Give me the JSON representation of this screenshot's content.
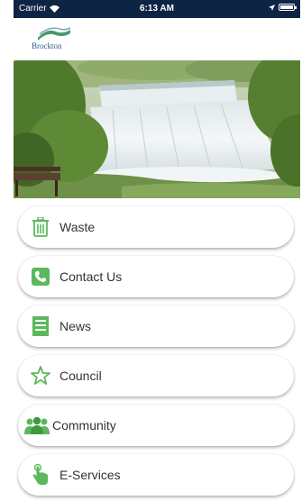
{
  "status_bar": {
    "carrier": "Carrier",
    "time": "6:13 AM"
  },
  "header": {
    "logo_text": "Brockton"
  },
  "hero": {
    "image": "waterfall-photo"
  },
  "menu": {
    "items": [
      {
        "label": "Waste",
        "icon": "trash-icon"
      },
      {
        "label": "Contact Us",
        "icon": "phone-icon"
      },
      {
        "label": "News",
        "icon": "news-icon"
      },
      {
        "label": "Council",
        "icon": "star-icon"
      },
      {
        "label": "Community",
        "icon": "people-icon"
      },
      {
        "label": "E-Services",
        "icon": "hand-tap-icon"
      }
    ]
  },
  "colors": {
    "status_bar_bg": "#0d2444",
    "icon_green": "#5cb85c",
    "text": "#333333"
  }
}
